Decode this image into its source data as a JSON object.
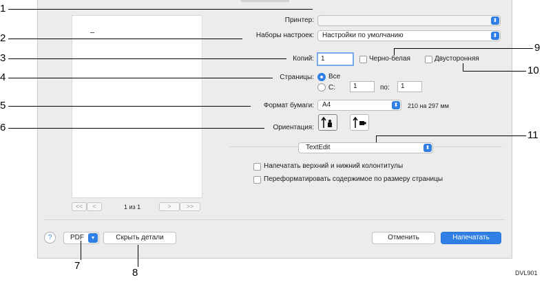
{
  "dialog": {
    "printer_label": "Принтер:",
    "printer_value": "",
    "presets_label": "Наборы настроек:",
    "presets_value": "Настройки по умолчанию",
    "copies_label": "Копий:",
    "copies_value": "1",
    "bw_label": "Черно-белая",
    "duplex_label": "Двусторонняя",
    "pages_label": "Страницы:",
    "pages_all": "Все",
    "pages_from": "С:",
    "pages_from_value": "1",
    "pages_to": "по:",
    "pages_to_value": "1",
    "paper_label": "Формат бумаги:",
    "paper_value": "A4",
    "paper_size": "210 на 297 мм",
    "orientation_label": "Ориентация:",
    "app_menu_value": "TextEdit",
    "header_footer_label": "Напечатать верхний и нижний колонтитулы",
    "reformat_label": "Переформатировать содержимое по размеру страницы",
    "page_indicator": "1 из 1",
    "nav_first": "<<",
    "nav_prev": "<",
    "nav_next": ">",
    "nav_last": ">>",
    "help": "?",
    "pdf": "PDF",
    "hide_details": "Скрыть детали",
    "cancel": "Отменить",
    "print": "Напечатать"
  },
  "callouts": [
    "1",
    "2",
    "3",
    "4",
    "5",
    "6",
    "7",
    "8",
    "9",
    "10",
    "11"
  ],
  "figure_code": "DVL901",
  "colors": {
    "accent": "#2f7fe4",
    "dialog_bg": "#ececec"
  }
}
